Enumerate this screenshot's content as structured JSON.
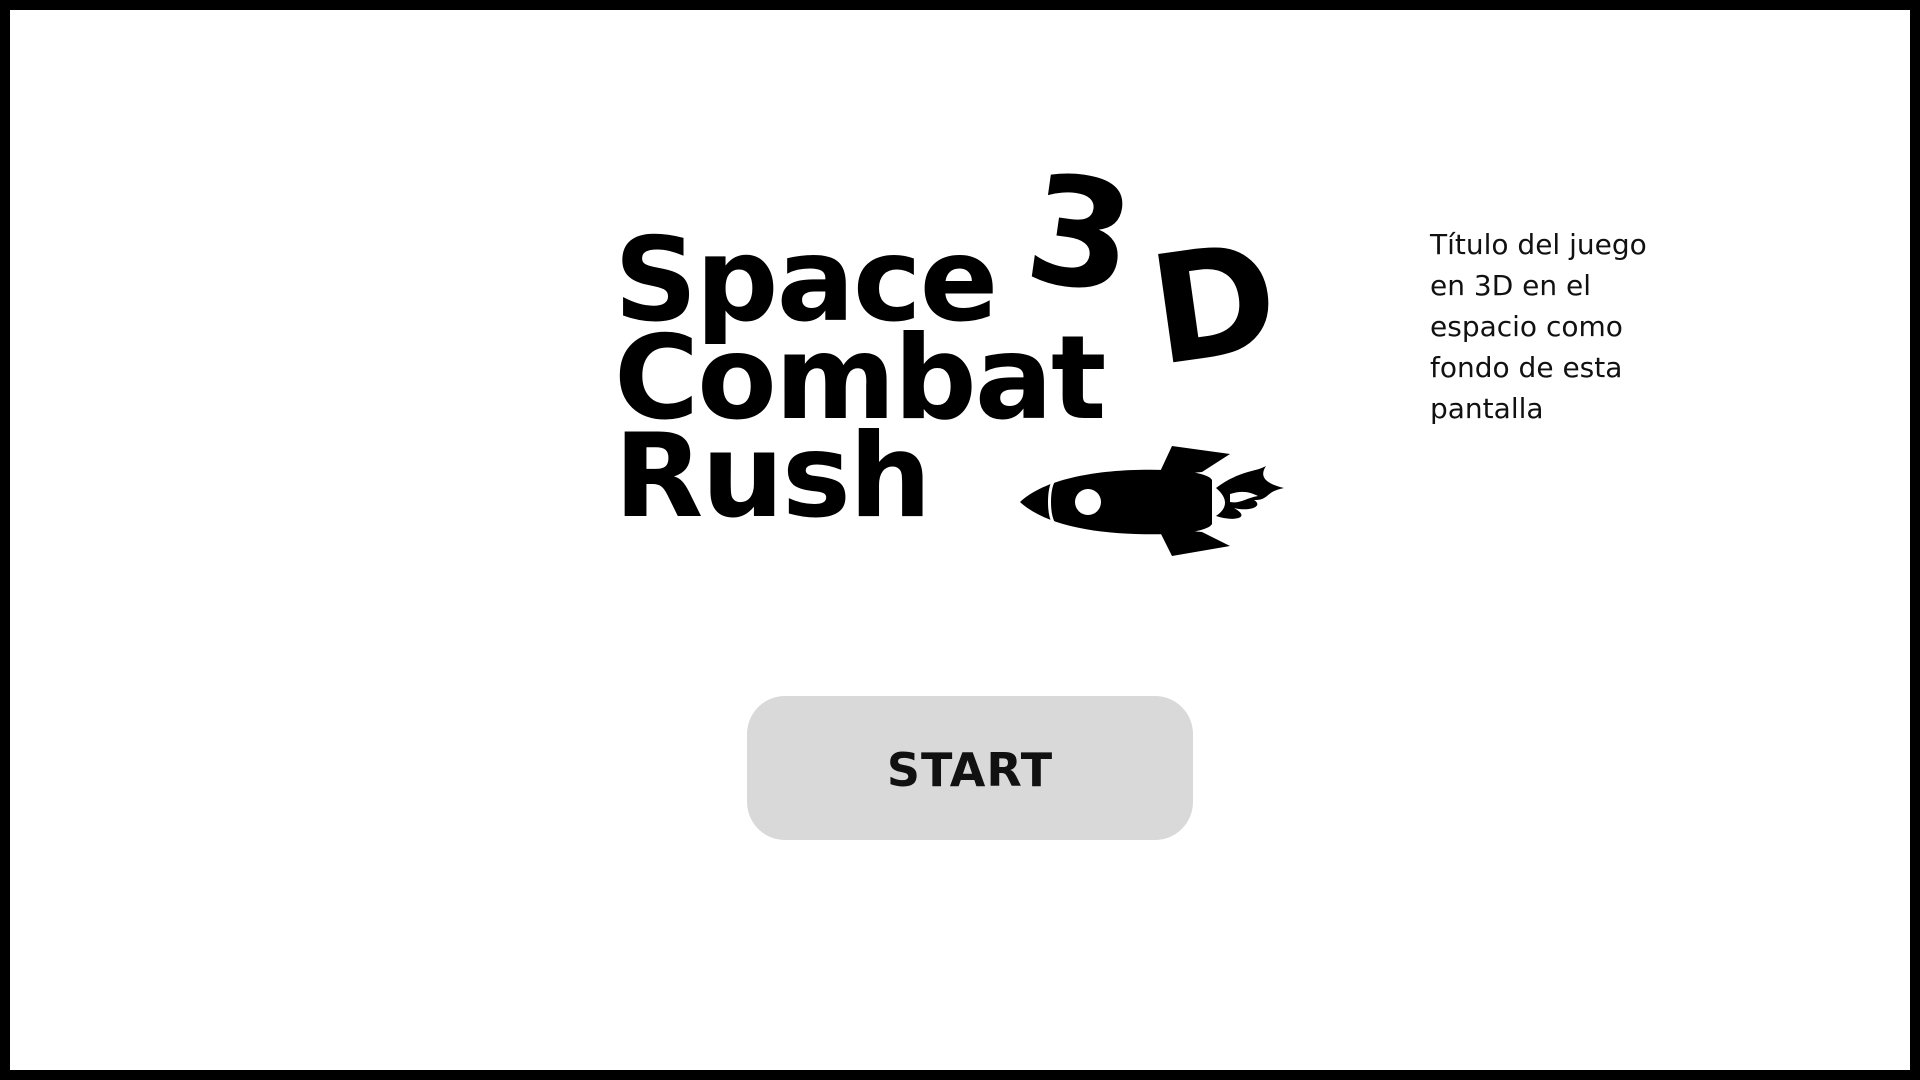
{
  "title": {
    "line1": "Space",
    "line2": "Combat",
    "line3": "Rush",
    "logo_3": "3",
    "logo_d": "D"
  },
  "note": {
    "text": "Título del juego en 3D en el espacio como fondo de esta pantalla"
  },
  "start_button": {
    "label": "START"
  },
  "icons": {
    "rocket": "rocket-icon"
  },
  "colors": {
    "background": "#ffffff",
    "frame": "#000000",
    "button": "#d9d9d9",
    "text": "#000000"
  }
}
